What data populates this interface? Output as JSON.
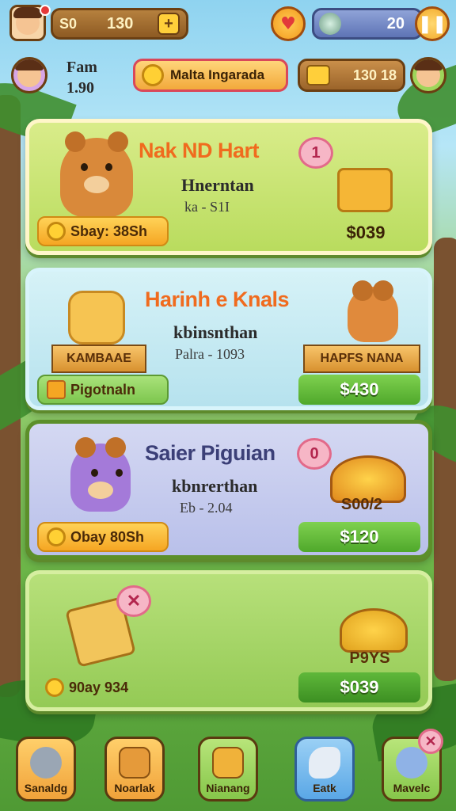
{
  "top_bar": {
    "coin_label": "S0",
    "coin_value": "130",
    "plus_icon": "plus-icon",
    "heart_icon": "heart-icon",
    "gem_value": "20",
    "pause_icon": "pause-icon",
    "player_name": "Fam",
    "player_value": "1.90",
    "shop_name": "Malta Ingarada",
    "chest_value": "130 18"
  },
  "cards": [
    {
      "title": "Nak ND Hart",
      "subtitle": "Hnerntan",
      "meta": "ka - S1I",
      "badge": "1",
      "buy_label": "Sbay: 38Sh",
      "price": "$039",
      "colors": {
        "bg": "#c9e37a",
        "title": "#f06b1e"
      }
    },
    {
      "title": "Harinh e Knals",
      "subtitle": "kbinsnthan",
      "meta": "Palra - 1093",
      "ribbon_left": "KAMBAAE",
      "ribbon_right": "HAPFS NANA",
      "buy_label": "Pigotnaln",
      "price": "$430",
      "colors": {
        "bg": "#c9ecf3",
        "title": "#f06b1e"
      }
    },
    {
      "title": "Saier Piguian",
      "subtitle": "kbnrerthan",
      "meta": "Eb - 2.04",
      "badge": "0",
      "buy_label": "Obay 80Sh",
      "reward_label": "S00/2",
      "price": "$120",
      "colors": {
        "bg": "#c9cfee",
        "title": "#3b3f77"
      }
    },
    {
      "buy_label": "90ay 934",
      "reward_label": "P9YS",
      "price": "$039",
      "colors": {
        "bg": "#a8d86a"
      }
    }
  ],
  "bottom_nav": [
    {
      "label": "Sanaldg",
      "icon": "bell-icon",
      "color": "#f5b144"
    },
    {
      "label": "Noarlak",
      "icon": "box-icon",
      "color": "#f5b144"
    },
    {
      "label": "Nianang",
      "icon": "chest-icon",
      "color": "#9ed65a"
    },
    {
      "label": "Eatk",
      "icon": "flag-icon",
      "color": "#6ab6ef"
    },
    {
      "label": "Mavelc",
      "icon": "blob-icon",
      "color": "#9ed65a"
    }
  ]
}
